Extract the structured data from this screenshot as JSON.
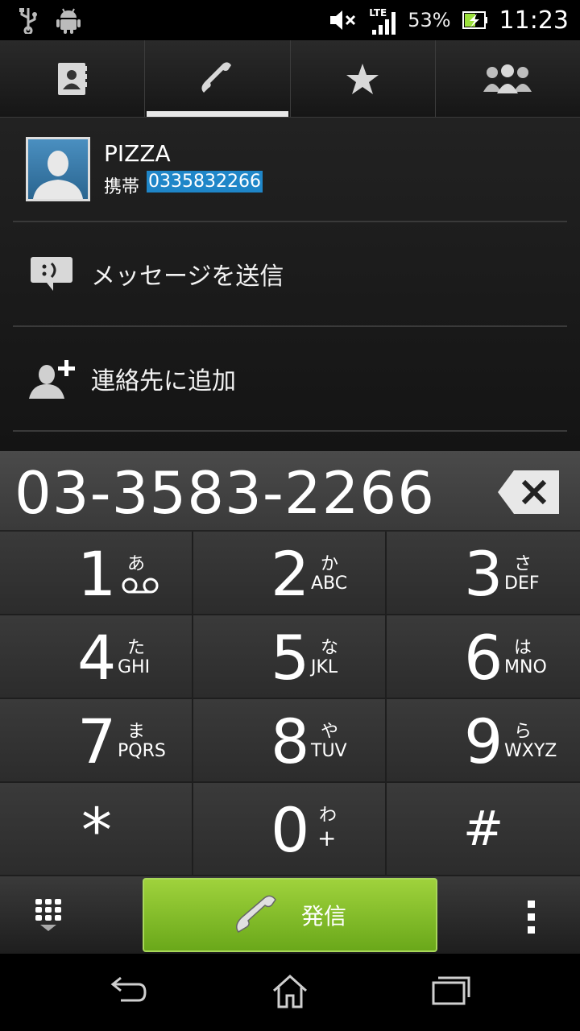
{
  "statusbar": {
    "network": "LTE",
    "battery": "53%",
    "time": "11:23",
    "icons": [
      "usb-icon",
      "android-debug-icon",
      "mute-icon",
      "signal-icon",
      "battery-icon"
    ]
  },
  "tabs": [
    {
      "name": "contacts",
      "icon": "contacts-book-icon",
      "active": false
    },
    {
      "name": "phone",
      "icon": "phone-handset-icon",
      "active": true
    },
    {
      "name": "favorites",
      "icon": "star-icon",
      "active": false
    },
    {
      "name": "groups",
      "icon": "group-icon",
      "active": false
    }
  ],
  "contact": {
    "name": "PIZZA",
    "type": "携帯",
    "number": "0335832266"
  },
  "actions": {
    "send_message": "メッセージを送信",
    "add_contact": "連絡先に追加"
  },
  "display": {
    "number": "03-3583-2266"
  },
  "keypad": [
    {
      "digit": "1",
      "kana": "あ",
      "letters": ""
    },
    {
      "digit": "2",
      "kana": "か",
      "letters": "ABC"
    },
    {
      "digit": "3",
      "kana": "さ",
      "letters": "DEF"
    },
    {
      "digit": "4",
      "kana": "た",
      "letters": "GHI"
    },
    {
      "digit": "5",
      "kana": "な",
      "letters": "JKL"
    },
    {
      "digit": "6",
      "kana": "は",
      "letters": "MNO"
    },
    {
      "digit": "7",
      "kana": "ま",
      "letters": "PQRS"
    },
    {
      "digit": "8",
      "kana": "や",
      "letters": "TUV"
    },
    {
      "digit": "9",
      "kana": "ら",
      "letters": "WXYZ"
    },
    {
      "digit": "*",
      "kana": "",
      "letters": ""
    },
    {
      "digit": "0",
      "kana": "わ",
      "letters": "+"
    },
    {
      "digit": "#",
      "kana": "",
      "letters": ""
    }
  ],
  "call_button": {
    "label": "発信"
  },
  "colors": {
    "call_green": "#8cc63f",
    "highlight_blue": "#1f86c8"
  }
}
